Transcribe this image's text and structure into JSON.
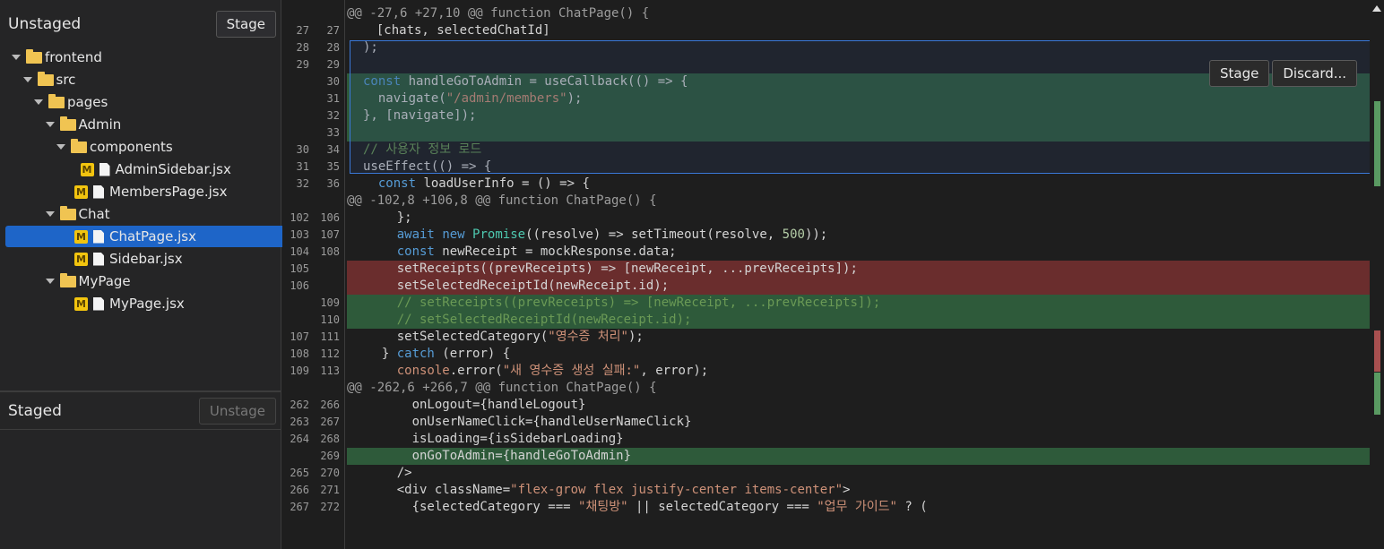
{
  "unstaged": {
    "title": "Unstaged",
    "stage_label": "Stage",
    "tree": [
      {
        "label": "frontend",
        "kind": "folder",
        "depth": 0
      },
      {
        "label": "src",
        "kind": "folder",
        "depth": 1
      },
      {
        "label": "pages",
        "kind": "folder",
        "depth": 2
      },
      {
        "label": "Admin",
        "kind": "folder",
        "depth": 3
      },
      {
        "label": "components",
        "kind": "folder",
        "depth": 4
      },
      {
        "label": "AdminSidebar.jsx",
        "kind": "file",
        "depth": 5,
        "badge": "M"
      },
      {
        "label": "MembersPage.jsx",
        "kind": "file",
        "depth": 4,
        "badge": "M"
      },
      {
        "label": "Chat",
        "kind": "folder",
        "depth": 3
      },
      {
        "label": "ChatPage.jsx",
        "kind": "file",
        "depth": 4,
        "badge": "M",
        "selected": true
      },
      {
        "label": "Sidebar.jsx",
        "kind": "file",
        "depth": 4,
        "badge": "M"
      },
      {
        "label": "MyPage",
        "kind": "folder",
        "depth": 3
      },
      {
        "label": "MyPage.jsx",
        "kind": "file",
        "depth": 4,
        "badge": "M"
      }
    ]
  },
  "staged": {
    "title": "Staged",
    "unstage_label": "Unstage"
  },
  "hunk_actions": {
    "stage_label": "Stage",
    "discard_label": "Discard..."
  },
  "colors": {
    "added": "#2e5a3a",
    "removed": "#6a2d2d",
    "selected": "#1e65c8",
    "badge": "#f2c40f"
  },
  "diff": [
    {
      "type": "hunk",
      "text": "@@ -27,6 +27,10 @@ function ChatPage() {"
    },
    {
      "type": "ctx",
      "o": "27",
      "n": "27",
      "text": "  [chats, selectedChatId]"
    },
    {
      "type": "ctx",
      "o": "28",
      "n": "28",
      "text": ");"
    },
    {
      "type": "ctx",
      "o": "29",
      "n": "29",
      "text": ""
    },
    {
      "type": "add",
      "o": "",
      "n": "30",
      "text": "const handleGoToAdmin = useCallback(() => {"
    },
    {
      "type": "add",
      "o": "",
      "n": "31",
      "text": "  navigate(\"/admin/members\");"
    },
    {
      "type": "add",
      "o": "",
      "n": "32",
      "text": "}, [navigate]);"
    },
    {
      "type": "add",
      "o": "",
      "n": "33",
      "text": ""
    },
    {
      "type": "ctx",
      "o": "30",
      "n": "34",
      "text": "// 사용자 정보 로드"
    },
    {
      "type": "ctx",
      "o": "31",
      "n": "35",
      "text": "useEffect(() => {"
    },
    {
      "type": "ctx",
      "o": "32",
      "n": "36",
      "text": "  const loadUserInfo = () => {"
    },
    {
      "type": "hunk",
      "text": "@@ -102,8 +106,8 @@ function ChatPage() {"
    },
    {
      "type": "ctx",
      "o": "102",
      "n": "106",
      "text": "    };"
    },
    {
      "type": "ctx",
      "o": "103",
      "n": "107",
      "text": "    await new Promise((resolve) => setTimeout(resolve, 500));"
    },
    {
      "type": "ctx",
      "o": "104",
      "n": "108",
      "text": "    const newReceipt = mockResponse.data;"
    },
    {
      "type": "del",
      "o": "105",
      "n": "",
      "text": "    setReceipts((prevReceipts) => [newReceipt, ...prevReceipts]);"
    },
    {
      "type": "del",
      "o": "106",
      "n": "",
      "text": "    setSelectedReceiptId(newReceipt.id);"
    },
    {
      "type": "add",
      "o": "",
      "n": "109",
      "text": "    // setReceipts((prevReceipts) => [newReceipt, ...prevReceipts]);"
    },
    {
      "type": "add",
      "o": "",
      "n": "110",
      "text": "    // setSelectedReceiptId(newReceipt.id);"
    },
    {
      "type": "ctx",
      "o": "107",
      "n": "111",
      "text": "    setSelectedCategory(\"영수증 처리\");"
    },
    {
      "type": "ctx",
      "o": "108",
      "n": "112",
      "text": "  } catch (error) {"
    },
    {
      "type": "ctx",
      "o": "109",
      "n": "113",
      "text": "    console.error(\"새 영수증 생성 실패:\", error);"
    },
    {
      "type": "hunk",
      "text": "@@ -262,6 +266,7 @@ function ChatPage() {"
    },
    {
      "type": "ctx",
      "o": "262",
      "n": "266",
      "text": "      onLogout={handleLogout}"
    },
    {
      "type": "ctx",
      "o": "263",
      "n": "267",
      "text": "      onUserNameClick={handleUserNameClick}"
    },
    {
      "type": "ctx",
      "o": "264",
      "n": "268",
      "text": "      isLoading={isSidebarLoading}"
    },
    {
      "type": "add",
      "o": "",
      "n": "269",
      "text": "      onGoToAdmin={handleGoToAdmin}"
    },
    {
      "type": "ctx",
      "o": "265",
      "n": "270",
      "text": "    />"
    },
    {
      "type": "ctx",
      "o": "266",
      "n": "271",
      "text": "    <div className=\"flex-grow flex justify-center items-center\">"
    },
    {
      "type": "ctx",
      "o": "267",
      "n": "272",
      "text": "      {selectedCategory === \"채팅방\" || selectedCategory === \"업무 가이드\" ? ("
    }
  ]
}
